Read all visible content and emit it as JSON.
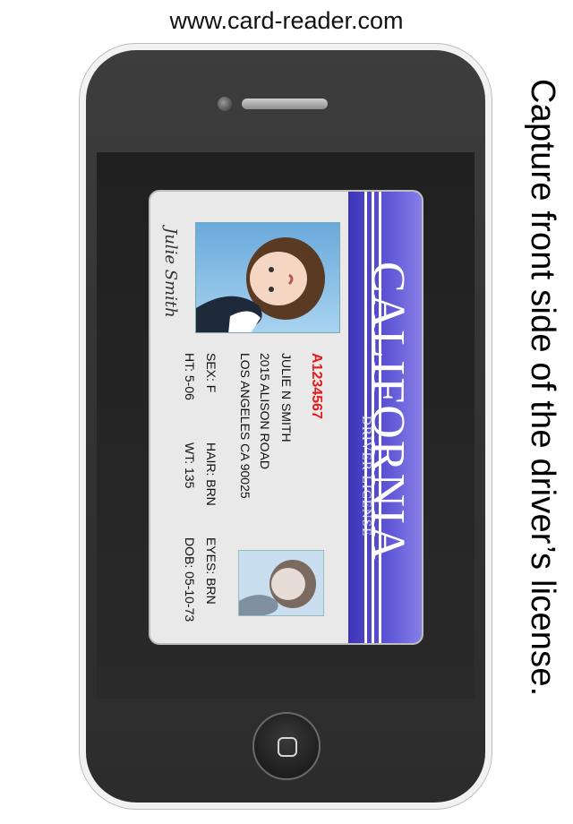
{
  "header": {
    "url": "www.card-reader.com"
  },
  "instruction": "Capture front side of the driver’s license.",
  "license": {
    "state": "CALIFORNIA",
    "type": "DRIVER LICENSE",
    "number": "A1234567",
    "name": "JULIE  N SMITH",
    "address1": "2015 ALISON ROAD",
    "address2": "LOS ANGELES CA 90025",
    "sex": "SEX: F",
    "hair": "HAIR: BRN",
    "eyes": "EYES: BRN",
    "height": "HT: 5-06",
    "weight": "WT: 135",
    "dob": "DOB: 05-10-73",
    "signature": "Julie Smith"
  },
  "colors": {
    "band": "#4a42c8",
    "number": "#e51b1b"
  },
  "icons": {
    "home": "home-square-icon",
    "camera": "camera-icon"
  }
}
